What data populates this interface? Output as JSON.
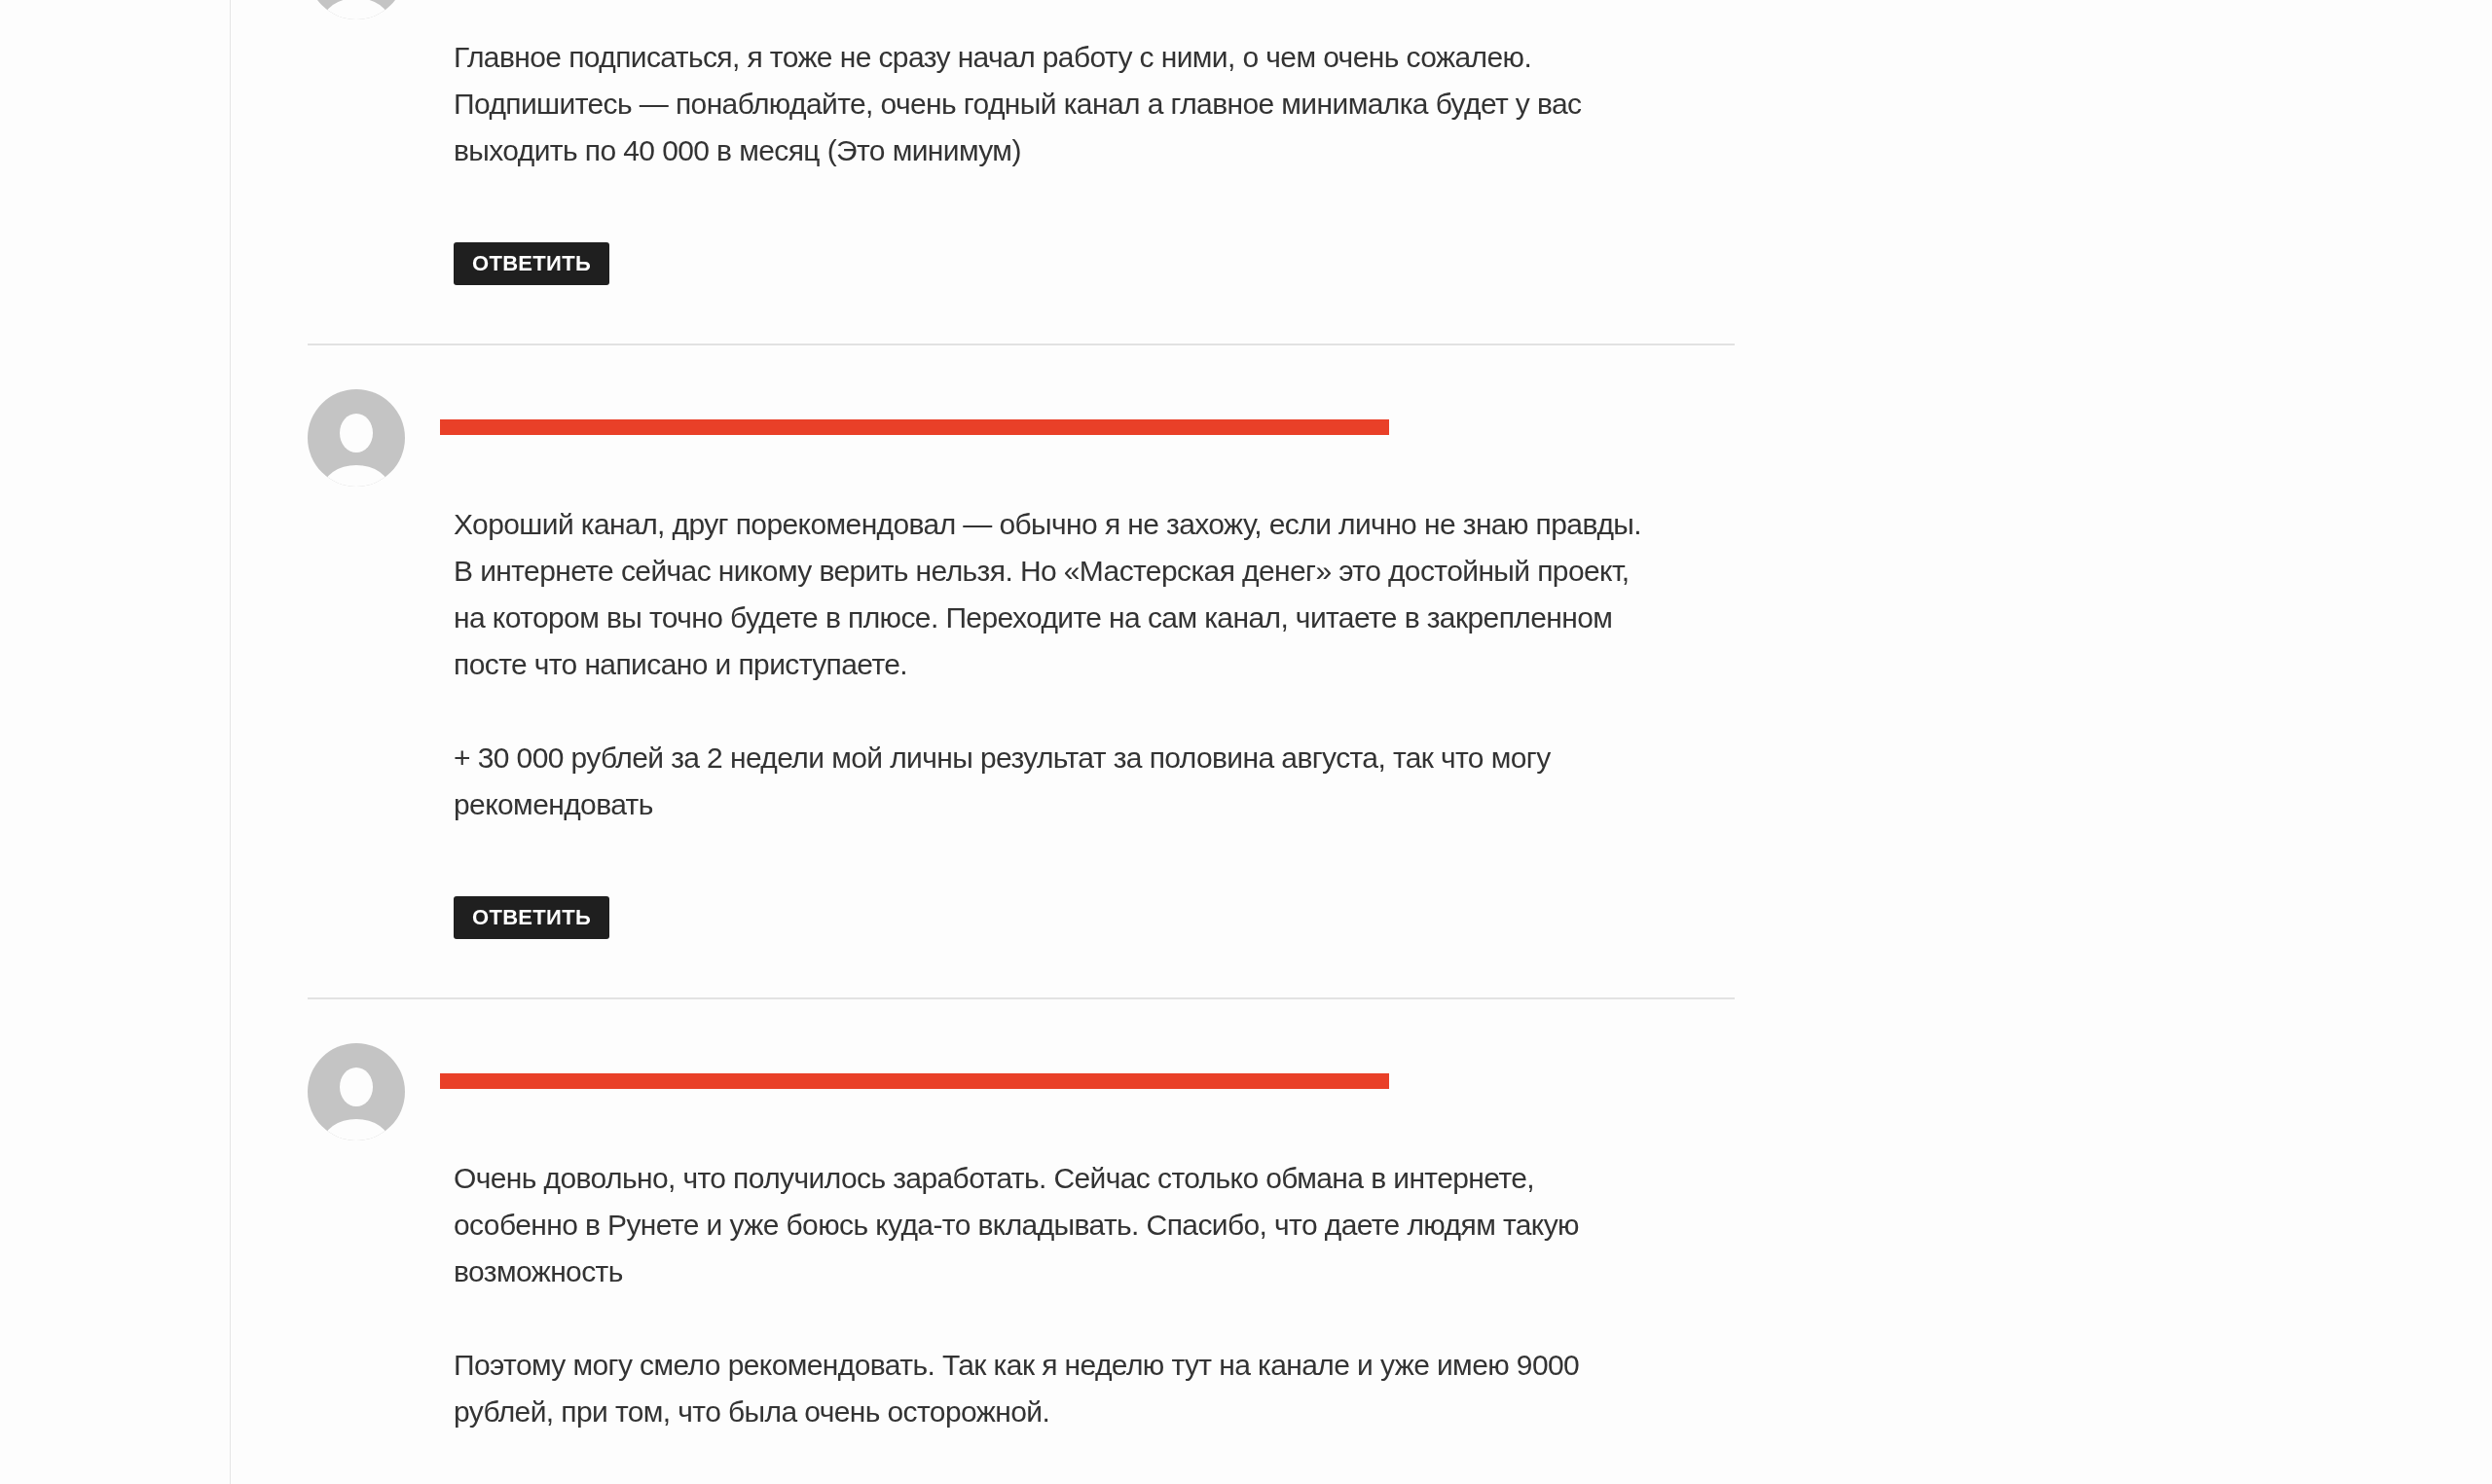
{
  "comments": [
    {
      "paragraphs": [
        "Главное подписаться, я тоже не сразу начал работу с ними, о чем очень сожалею. Подпишитесь — понаблюдайте, очень годный канал а главное минималка будет у вас выходить по 40 000 в месяц (Это минимум)"
      ],
      "reply_button": "ОТВЕТИТЬ"
    },
    {
      "header_redacted": true,
      "paragraphs": [
        "Хороший канал, друг порекомендовал — обычно я не захожу, если лично не знаю правды. В интернете сейчас никому верить нельзя. Но «Мастерская денег» это достойный проект, на котором вы точно будете в плюсе. Переходите на сам канал, читаете в закрепленном посте что написано и приступаете.",
        "+ 30 000 рублей за 2 недели мой личны результат за половина августа, так что могу рекомендовать"
      ],
      "reply_button": "ОТВЕТИТЬ"
    },
    {
      "header_redacted": true,
      "paragraphs": [
        "Очень довольно, что получилось заработать. Сейчас столько обмана в интернете, особенно в Рунете и уже боюсь куда-то вкладывать. Спасибо, что даете людям такую возможность",
        "Поэтому могу смело рекомендовать. Так как я неделю тут на канале и уже имею 9000 рублей, при том, что была очень осторожной."
      ]
    }
  ]
}
